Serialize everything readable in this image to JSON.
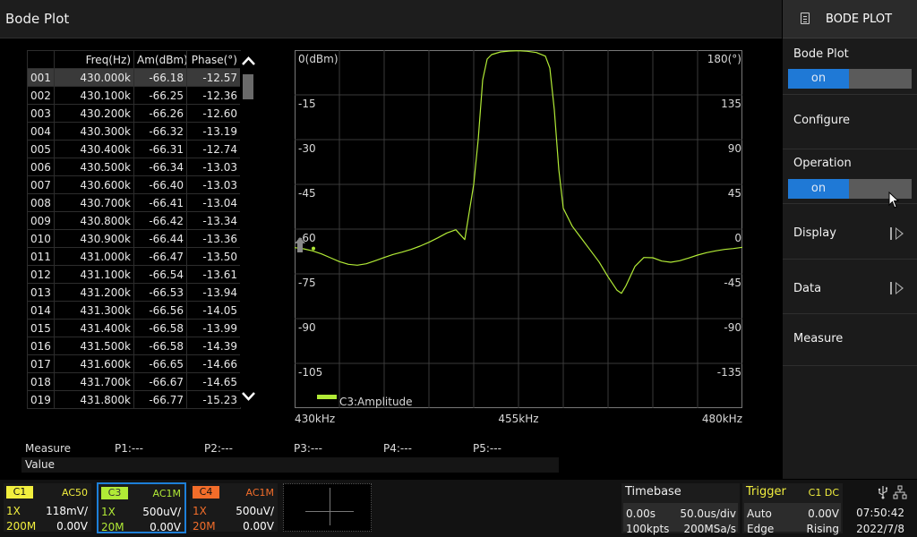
{
  "title": "Bode Plot",
  "menu": {
    "header": "BODE PLOT",
    "bode_plot": {
      "label": "Bode Plot",
      "state": "on"
    },
    "configure": {
      "label": "Configure"
    },
    "operation": {
      "label": "Operation",
      "state": "on"
    },
    "display": {
      "label": "Display"
    },
    "data": {
      "label": "Data"
    },
    "measure": {
      "label": "Measure"
    }
  },
  "table": {
    "headers": [
      "",
      "Freq(Hz)",
      "Am(dBm)",
      "Phase(°)"
    ],
    "rows": [
      [
        "001",
        "430.000k",
        "-66.18",
        "-12.57"
      ],
      [
        "002",
        "430.100k",
        "-66.25",
        "-12.36"
      ],
      [
        "003",
        "430.200k",
        "-66.26",
        "-12.60"
      ],
      [
        "004",
        "430.300k",
        "-66.32",
        "-13.19"
      ],
      [
        "005",
        "430.400k",
        "-66.31",
        "-12.74"
      ],
      [
        "006",
        "430.500k",
        "-66.34",
        "-13.03"
      ],
      [
        "007",
        "430.600k",
        "-66.40",
        "-13.03"
      ],
      [
        "008",
        "430.700k",
        "-66.41",
        "-13.04"
      ],
      [
        "009",
        "430.800k",
        "-66.42",
        "-13.34"
      ],
      [
        "010",
        "430.900k",
        "-66.44",
        "-13.36"
      ],
      [
        "011",
        "431.000k",
        "-66.47",
        "-13.50"
      ],
      [
        "012",
        "431.100k",
        "-66.54",
        "-13.61"
      ],
      [
        "013",
        "431.200k",
        "-66.53",
        "-13.94"
      ],
      [
        "014",
        "431.300k",
        "-66.56",
        "-14.05"
      ],
      [
        "015",
        "431.400k",
        "-66.58",
        "-13.99"
      ],
      [
        "016",
        "431.500k",
        "-66.58",
        "-14.39"
      ],
      [
        "017",
        "431.600k",
        "-66.65",
        "-14.66"
      ],
      [
        "018",
        "431.700k",
        "-66.67",
        "-14.65"
      ],
      [
        "019",
        "431.800k",
        "-66.77",
        "-15.23"
      ]
    ]
  },
  "chart_data": {
    "type": "line",
    "series": [
      {
        "name": "C3:Amplitude",
        "color": "#b1ea36",
        "x": [
          430,
          431,
          432,
          433,
          434,
          435,
          436,
          437,
          438,
          439,
          440,
          441,
          442,
          443,
          444,
          445,
          446,
          447,
          448,
          449,
          450,
          450.5,
          451,
          451.5,
          452,
          453,
          454,
          455,
          456,
          457,
          458,
          458.5,
          459,
          459.5,
          460,
          461,
          462,
          463,
          464,
          465,
          466,
          466.5,
          467,
          468,
          469,
          470,
          471,
          472,
          473,
          474,
          475,
          476,
          477,
          478,
          479,
          480
        ],
        "y": [
          -66.2,
          -66.6,
          -67.3,
          -68.3,
          -69.6,
          -70.9,
          -71.8,
          -72.1,
          -71.6,
          -70.6,
          -69.5,
          -68.5,
          -67.7,
          -66.8,
          -65.7,
          -64.4,
          -62.9,
          -61.3,
          -60.2,
          -63.5,
          -45,
          -30,
          -10,
          -3,
          -1.5,
          -0.6,
          -0.3,
          -0.2,
          -0.4,
          -0.8,
          -2,
          -6,
          -20,
          -40,
          -53,
          -59,
          -63,
          -67,
          -71,
          -76,
          -80.5,
          -81.5,
          -79,
          -72.5,
          -69.5,
          -69.6,
          -70.7,
          -71.1,
          -70.6,
          -69.7,
          -68.7,
          -67.9,
          -67.3,
          -66.8,
          -66.5,
          -66.1
        ]
      }
    ],
    "x_ticks": [
      "430kHz",
      "455kHz",
      "480kHz"
    ],
    "xlim": [
      430,
      480
    ],
    "y_left_ticks": [
      "0(dBm)",
      "-15",
      "-30",
      "-45",
      "-60",
      "-75",
      "-90",
      "-105"
    ],
    "y_right_ticks": [
      "180(°)",
      "135",
      "90",
      "45",
      "0",
      "-45",
      "-90",
      "-135"
    ],
    "ylim": [
      -120,
      0
    ],
    "grid": true,
    "legend": "bottom-left"
  },
  "measure": {
    "label": "Measure",
    "p1": "P1:---",
    "p2": "P2:---",
    "p3": "P3:---",
    "p4": "P4:---",
    "p5": "P5:---",
    "value_label": "Value"
  },
  "channels": {
    "c1": {
      "tag": "C1",
      "coupling": "AC50",
      "probe": "1X",
      "scale": "118mV/",
      "bw": "200M",
      "offset": "0.00V"
    },
    "c3": {
      "tag": "C3",
      "coupling": "AC1M",
      "probe": "1X",
      "scale": "500uV/",
      "bw": "20M",
      "offset": "0.00V"
    },
    "c4": {
      "tag": "C4",
      "coupling": "AC1M",
      "probe": "1X",
      "scale": "500uV/",
      "bw": "20M",
      "offset": "0.00V"
    }
  },
  "timebase": {
    "label": "Timebase",
    "delay": "0.00s",
    "scale": "50.0us/div",
    "points": "100kpts",
    "rate": "200MSa/s"
  },
  "trigger": {
    "label": "Trigger",
    "source": "C1 DC",
    "mode": "Auto",
    "level": "0.00V",
    "type": "Edge",
    "slope": "Rising"
  },
  "system": {
    "time": "07:50:42",
    "date": "2022/7/8"
  }
}
